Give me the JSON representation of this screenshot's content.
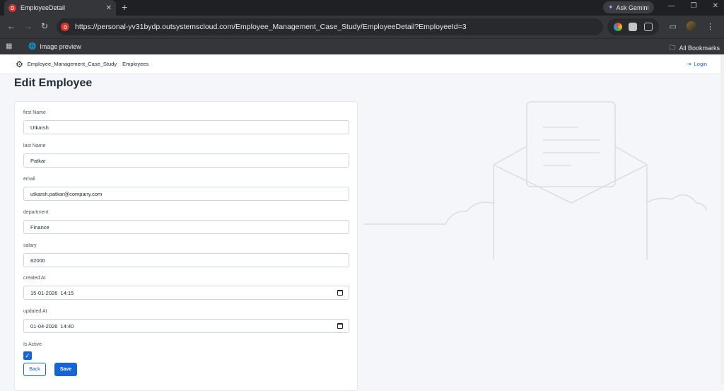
{
  "browser": {
    "tab_title": "EmployeeDetail",
    "tab_close": "✕",
    "new_tab": "+",
    "ask_gemini": "Ask Gemini",
    "url": "https://personal-yv31bydp.outsystemscloud.com/Employee_Management_Case_Study/EmployeeDetail?EmployeeId=3",
    "bookmark_item": "Image preview",
    "all_bookmarks": "All Bookmarks"
  },
  "app": {
    "name": "Employee_Management_Case_Study",
    "menu_employees": "Employees",
    "login": "Login",
    "page_title": "Edit Employee"
  },
  "form": {
    "first_name_label": "first Name",
    "first_name_value": "Utkarsh",
    "last_name_label": "last Name",
    "last_name_value": "Patkar",
    "email_label": "email",
    "email_value": "utkarsh.patkar@company.com",
    "department_label": "department",
    "department_value": "Finance",
    "salary_label": "salary",
    "salary_value": "82000",
    "created_label": "created At",
    "created_value": "15-01-2026  14:15",
    "updated_label": "updated At",
    "updated_value": "01-04-2026  14:40",
    "active_label": "Is Active",
    "active_checked": true,
    "back_label": "Back",
    "save_label": "Save"
  },
  "colors": {
    "primary": "#1565d8",
    "tab_bg": "#35363a",
    "page_bg": "#f4f6f9"
  }
}
